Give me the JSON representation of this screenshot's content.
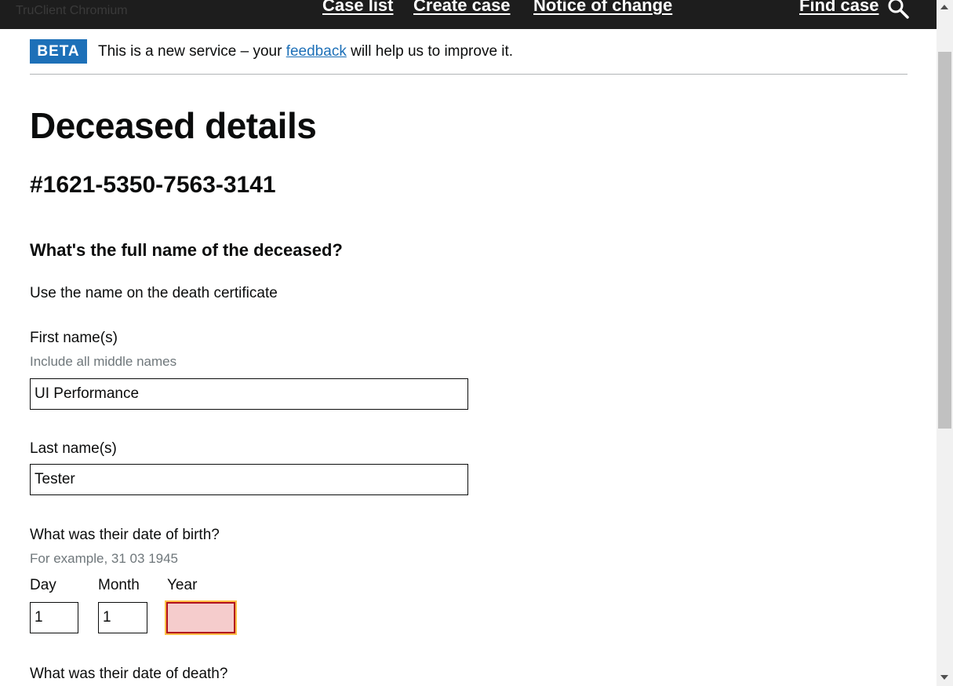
{
  "window": {
    "title": "TruClient Chromium"
  },
  "nav": {
    "case_list": "Case list",
    "create_case": "Create case",
    "notice_of_change": "Notice of change",
    "find_case": "Find case"
  },
  "beta": {
    "tag": "BETA",
    "text_before": "This is a new service – your",
    "link": "feedback",
    "text_after": "will help us to improve it."
  },
  "page": {
    "title": "Deceased details",
    "case_number": "#1621-5350-7563-3141"
  },
  "form": {
    "name_question": "What's the full name of the deceased?",
    "name_hint": "Use the name on the death certificate",
    "first_name_label": "First name(s)",
    "first_name_hint": "Include all middle names",
    "first_name_value": "UI Performance",
    "last_name_label": "Last name(s)",
    "last_name_value": "Tester",
    "dob_question": "What was their date of birth?",
    "dob_hint": "For example, 31 03 1945",
    "day_label": "Day",
    "month_label": "Month",
    "year_label": "Year",
    "day_value": "1",
    "month_value": "1",
    "year_value": "",
    "dod_question": "What was their date of death?"
  },
  "colors": {
    "header_bg": "#1d1d1d",
    "beta_tag": "#1d70b8",
    "link": "#1d70b8",
    "error_fill": "#f5cccc",
    "focus": "#ffbf47"
  }
}
